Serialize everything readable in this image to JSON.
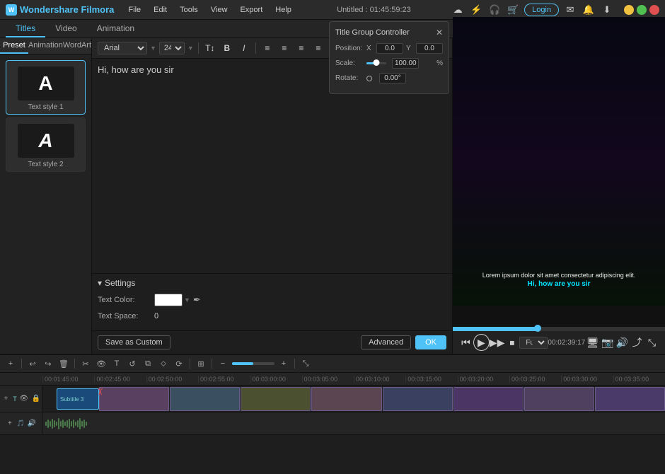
{
  "app": {
    "name": "Wondershare Filmora",
    "title": "Untitled : 01:45:59:23"
  },
  "menu": {
    "items": [
      "File",
      "Edit",
      "Tools",
      "View",
      "Export",
      "Help"
    ]
  },
  "main_tabs": [
    "Titles",
    "Video",
    "Animation"
  ],
  "sub_tabs": [
    "Preset",
    "Animation",
    "WordArt"
  ],
  "style_items": [
    {
      "letter": "A",
      "label": "Text style 1"
    },
    {
      "letter": "A",
      "label": "Text style 2"
    }
  ],
  "editor": {
    "font": "Arial",
    "size": "24",
    "text": "Hi, how are you sir",
    "bold_label": "B",
    "italic_label": "I"
  },
  "settings": {
    "header": "Settings",
    "text_color_label": "Text Color:",
    "text_space_label": "Text Space:",
    "text_space_value": "0"
  },
  "actions": {
    "save_custom": "Save as Custom",
    "advanced": "Advanced",
    "ok": "OK"
  },
  "tgc": {
    "title": "Title Group Controller",
    "position_label": "Position:",
    "x_label": "X",
    "y_label": "Y",
    "x_value": "0.0",
    "y_value": "0.0",
    "scale_label": "Scale:",
    "scale_value": "100.00",
    "scale_unit": "%",
    "rotate_label": "Rotate:",
    "rotate_value": "0.00°"
  },
  "preview": {
    "lorem": "Lorem ipsum dolor sit amet consectetur adipiscing elit.",
    "subtitle": "Hi, how are you sir",
    "time": "00:02:39:17",
    "quality": "Full"
  },
  "timeline": {
    "ruler_marks": [
      "00:01:45:00",
      "00:02:45:00",
      "00:02:50:00",
      "00:02:55:00",
      "00:03:00:00",
      "00:03:05:00",
      "00:03:10:00",
      "00:03:15:00",
      "00:03:20:00",
      "00:03:25:00",
      "00:03:30:00",
      "00:03:35:00"
    ],
    "subtitle_label": "Subtitle 3"
  }
}
